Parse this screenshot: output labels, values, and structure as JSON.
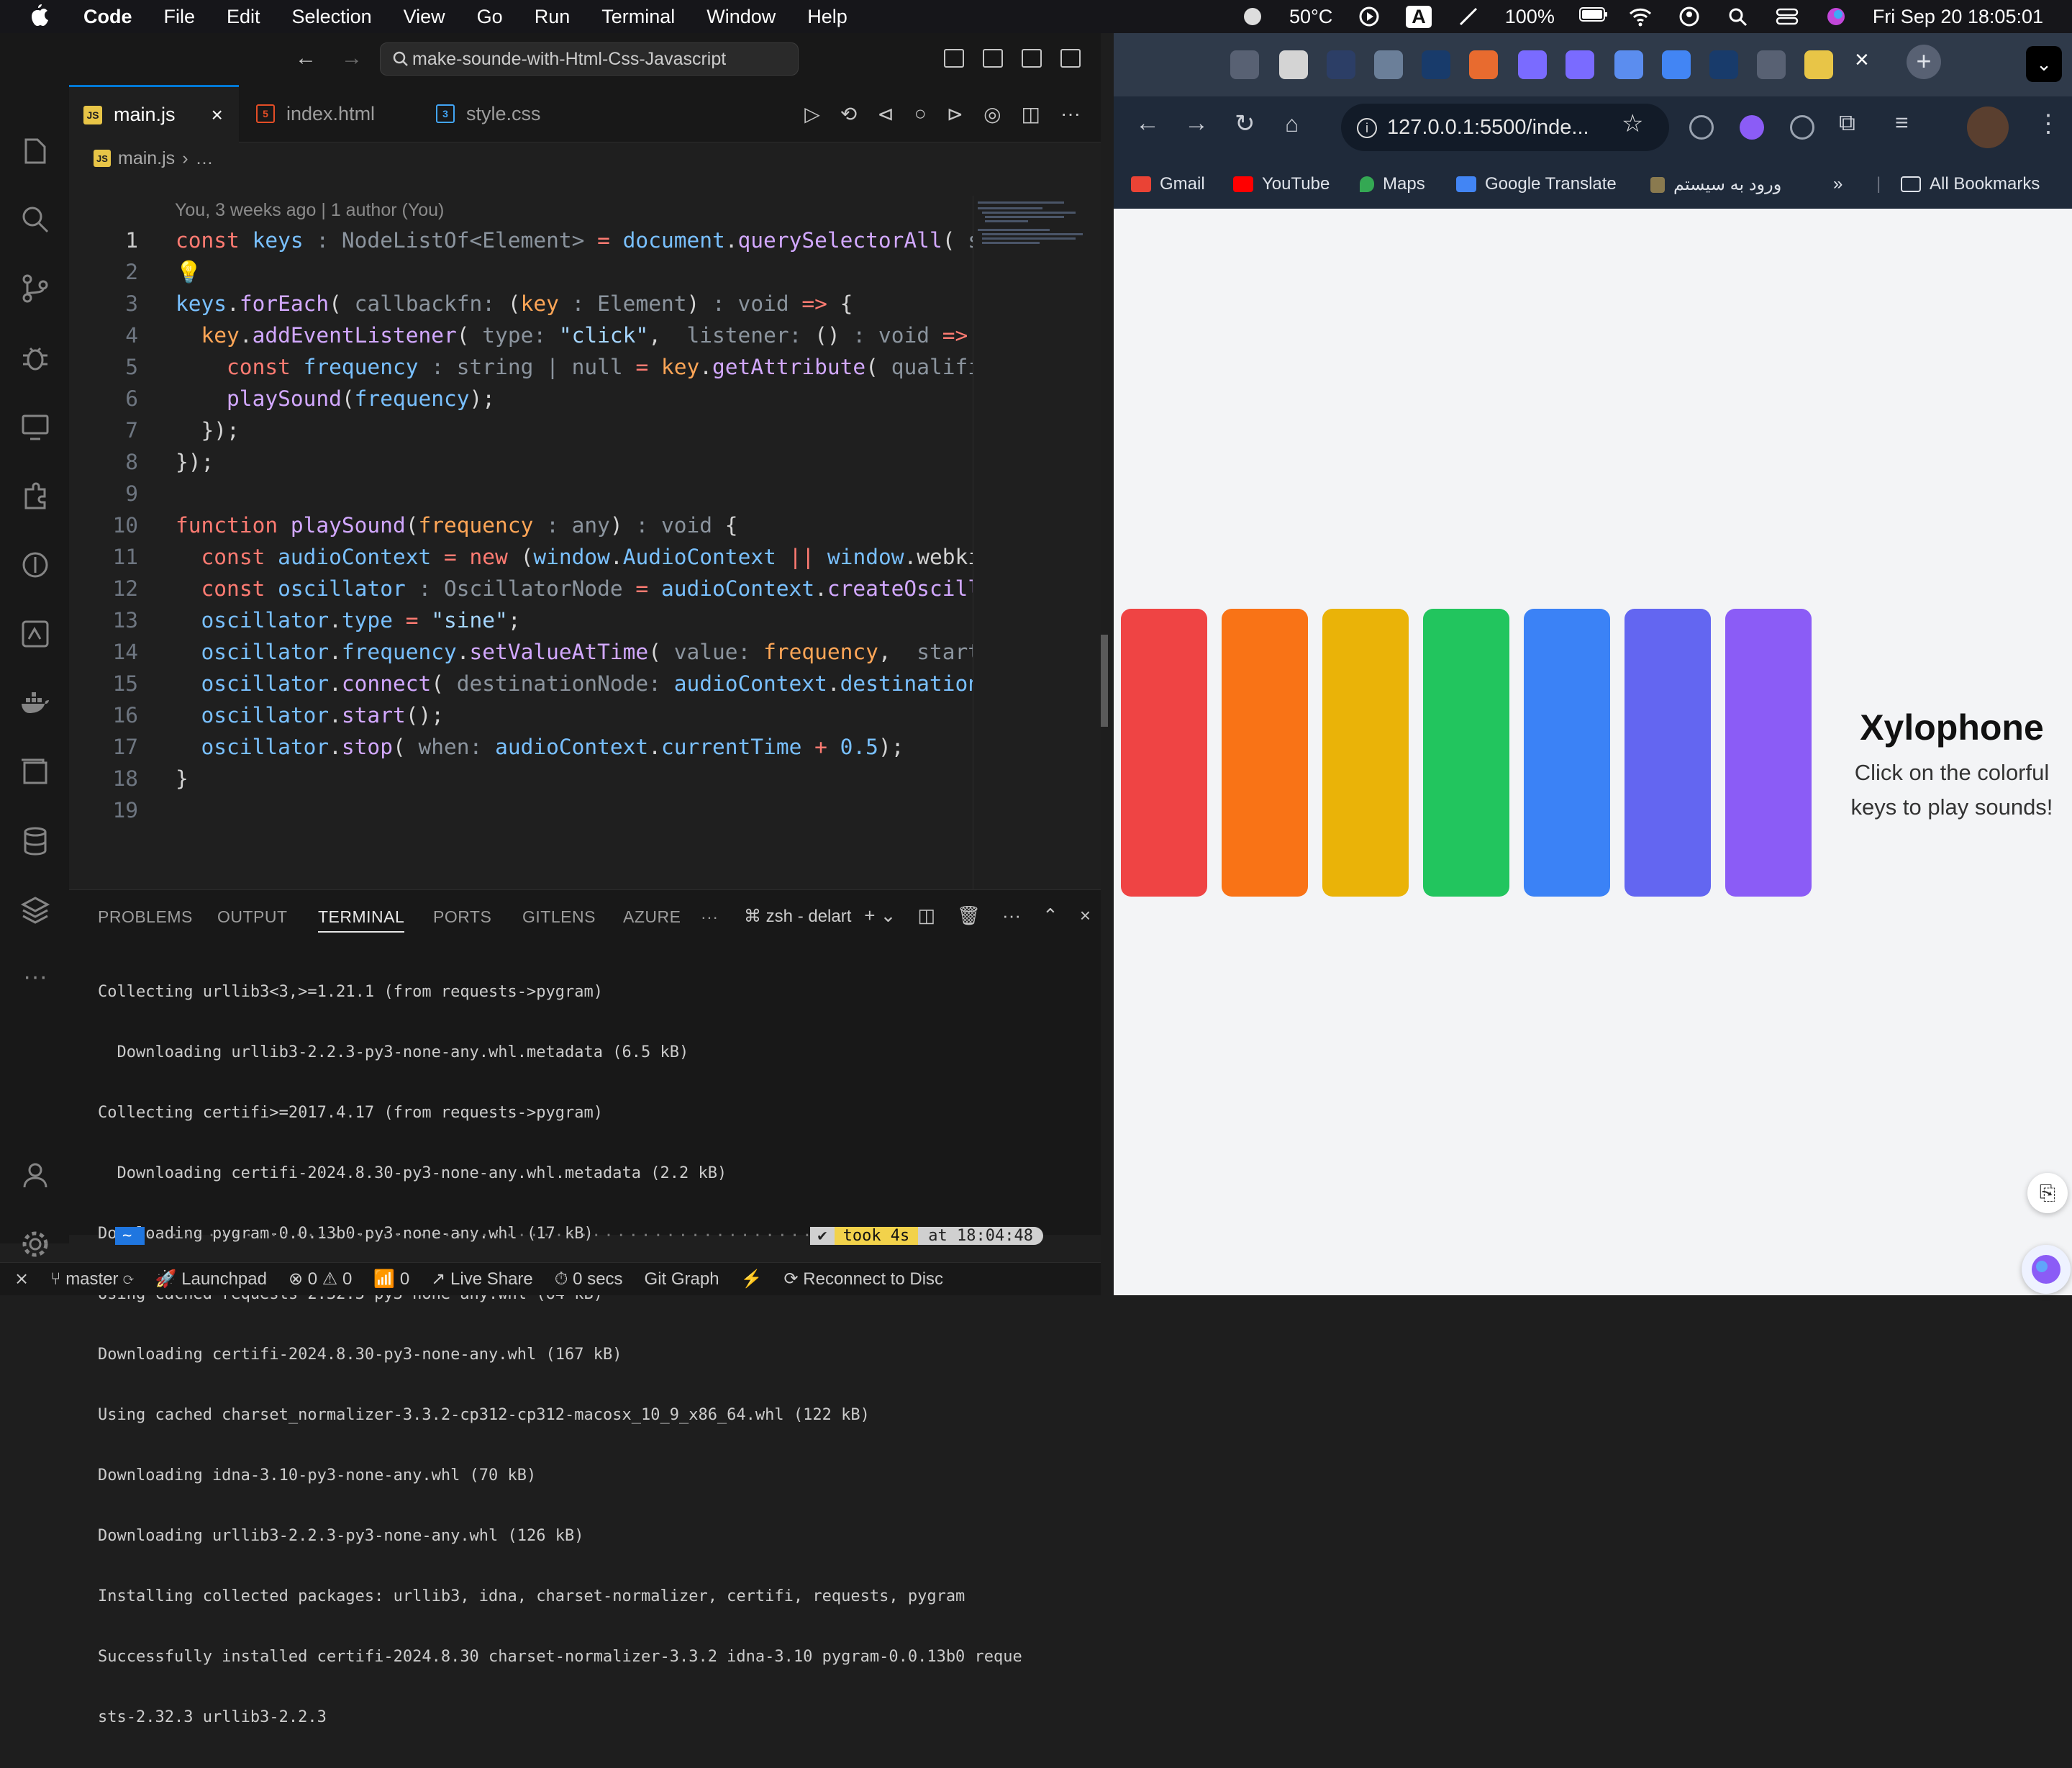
{
  "menubar": {
    "app_name": "Code",
    "items": [
      "File",
      "Edit",
      "Selection",
      "View",
      "Go",
      "Run",
      "Terminal",
      "Window",
      "Help"
    ],
    "temperature": "50°C",
    "battery": "100%",
    "input_source": "A",
    "clock": "Fri Sep 20  18:05:01"
  },
  "vscode": {
    "search_text": "make-sounde-with-Html-Css-Javascript",
    "tabs": [
      {
        "label": "main.js",
        "badge": "JS"
      },
      {
        "label": "index.html",
        "badge": "5"
      },
      {
        "label": "style.css",
        "badge": "3"
      }
    ],
    "breadcrumb": {
      "file": "main.js",
      "rest": "…"
    },
    "blame": "You, 3 weeks ago | 1 author (You)",
    "code_lines": [
      "1",
      "2",
      "3",
      "4",
      "5",
      "6",
      "7",
      "8",
      "9",
      "10",
      "11",
      "12",
      "13",
      "14",
      "15",
      "16",
      "17",
      "18",
      "19"
    ],
    "panel": {
      "tabs": [
        "PROBLEMS",
        "OUTPUT",
        "TERMINAL",
        "PORTS",
        "GITLENS",
        "AZURE"
      ],
      "shell": "zsh - delart",
      "terminal_lines": [
        "Collecting urllib3<3,>=1.21.1 (from requests->pygram)",
        "  Downloading urllib3-2.2.3-py3-none-any.whl.metadata (6.5 kB)",
        "Collecting certifi>=2017.4.17 (from requests->pygram)",
        "  Downloading certifi-2024.8.30-py3-none-any.whl.metadata (2.2 kB)",
        "Downloading pygram-0.0.13b0-py3-none-any.whl (17 kB)",
        "Using cached requests-2.32.3-py3-none-any.whl (64 kB)",
        "Downloading certifi-2024.8.30-py3-none-any.whl (167 kB)",
        "Using cached charset_normalizer-3.3.2-cp312-cp312-macosx_10_9_x86_64.whl (122 kB)",
        "Downloading idna-3.10-py3-none-any.whl (70 kB)",
        "Downloading urllib3-2.2.3-py3-none-any.whl (126 kB)",
        "Installing collected packages: urllib3, idna, charset-normalizer, certifi, requests, pygram",
        "Successfully installed certifi-2024.8.30 charset-normalizer-3.3.2 idna-3.10 pygram-0.0.13b0 reque",
        "sts-2.32.3 urllib3-2.2.3"
      ],
      "prompt": {
        "dir": "~",
        "status": "✔",
        "took": "took 4s",
        "time": "at 18:04:48"
      }
    },
    "status": {
      "branch": "master",
      "launchpad": "Launchpad",
      "errors": "0",
      "warnings": "0",
      "ports": "0",
      "live_share": "Live Share",
      "secs": "0 secs",
      "git_graph": "Git Graph",
      "reconnect": "Reconnect to Disc"
    }
  },
  "chrome": {
    "url": "127.0.0.1:5500/inde...",
    "bookmarks": [
      "Gmail",
      "YouTube",
      "Maps",
      "Google Translate",
      "ورود به سیستم",
      "All Bookmarks"
    ],
    "page": {
      "title": "Xylophone",
      "subtitle": "Click on the colorful keys to play sounds!",
      "key_colors": [
        "#ef4444",
        "#f97316",
        "#eab308",
        "#22c55e",
        "#3b82f6",
        "#6366f1",
        "#8b5cf6"
      ]
    }
  }
}
